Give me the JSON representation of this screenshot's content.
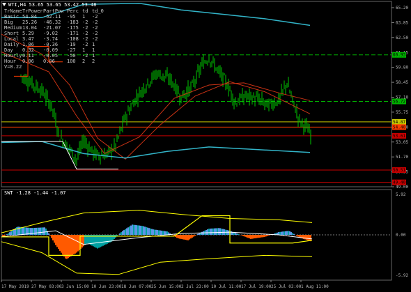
{
  "main_title": "WTI,H4 53.65 53.65 53.42 53.48",
  "table": {
    "headers": [
      "TrName",
      "TrPower",
      "PartPow",
      "Perc",
      "td",
      "td_0"
    ],
    "rows": [
      [
        "Basic",
        "54.84",
        "-52.11",
        "-95",
        "1",
        "-2"
      ],
      [
        "Big",
        "25.26",
        "-46.32",
        "-183",
        "-2",
        "-2"
      ],
      [
        "Medium",
        "13.04",
        "-21.07",
        "-175",
        "-2",
        "-2"
      ],
      [
        "Short",
        "5.29",
        "-9.02",
        "-171",
        "-2",
        "-2"
      ],
      [
        "Local",
        "3.47",
        "-3.74",
        "-108",
        "-2",
        "-2"
      ],
      [
        "Daily",
        "1.86",
        "-0.36",
        "-19",
        "-2",
        "1"
      ],
      [
        "Day",
        "0.32",
        "-0.09",
        "-27",
        "1",
        "1"
      ],
      [
        "Hourly",
        "0.11",
        "-0.05",
        "-50",
        "-2",
        "1"
      ],
      [
        "Hour",
        "0.06",
        "0.06",
        "100",
        "2",
        "2"
      ]
    ],
    "footer": "V=0.22"
  },
  "price_axis": [
    "65.20",
    "63.85",
    "62.50",
    "61.15",
    "59.80",
    "58.45",
    "57.10",
    "55.75",
    "54.40",
    "53.05",
    "51.70",
    "50.35",
    "49.00"
  ],
  "price_tags": [
    {
      "value": "60.93",
      "color": "#00b400"
    },
    {
      "value": "56.72",
      "color": "#00b400"
    },
    {
      "value": "54.87",
      "color": "#c8c800"
    },
    {
      "value": "54.40",
      "color": "#ff3c00"
    },
    {
      "value": "53.61",
      "color": "#c80000"
    },
    {
      "value": "50.51",
      "color": "#c80000"
    },
    {
      "value": "49.40",
      "color": "#c80000"
    }
  ],
  "sub_title": "SWT -1.28 -1.44 -1.07",
  "sub_axis": [
    "5.92",
    "0.00",
    "-5.92"
  ],
  "time_axis": [
    "17 May 2019",
    "27 May 03:00",
    "3 Jun 15:00",
    "10 Jun 23:00",
    "18 Jun 07:00",
    "25 Jun 15:00",
    "2 Jul 23:00",
    "10 Jul 11:00",
    "17 Jul 19:00",
    "25 Jul 03:00",
    "1 Aug 11:00"
  ],
  "colors": {
    "background": "#000000",
    "candle": "#00c800",
    "ma_red": "#c83214",
    "channel_cyan": "#32b4c8",
    "hist_orange": "#ff5a00",
    "hist_teal": "#00a0a0",
    "hist_blue": "#5a96e6",
    "signal_yellow": "#ffff00"
  }
}
